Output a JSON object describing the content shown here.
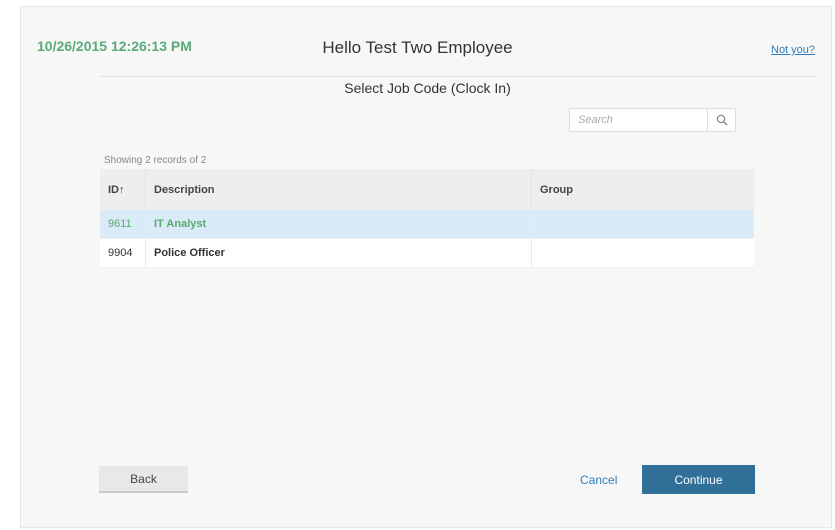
{
  "header": {
    "timestamp": "10/26/2015 12:26:13 PM",
    "greeting": "Hello Test Two Employee",
    "not_you_link": "Not you?"
  },
  "subtitle": "Select Job Code (Clock In)",
  "search": {
    "placeholder": "Search",
    "value": "",
    "icon": "search-icon"
  },
  "table": {
    "records_label": "Showing 2 records of 2",
    "columns": {
      "id": "ID↑",
      "description": "Description",
      "group": "Group"
    },
    "rows": [
      {
        "id": "9611",
        "description": "IT Analyst",
        "group": "",
        "selected": true
      },
      {
        "id": "9904",
        "description": "Police Officer",
        "group": "",
        "selected": false
      }
    ]
  },
  "footer": {
    "back_label": "Back",
    "cancel_label": "Cancel",
    "continue_label": "Continue"
  },
  "colors": {
    "timestamp": "#5aaa7a",
    "link": "#2f7fbf",
    "primary_button": "#2f6f98",
    "selected_row_bg": "#d8ebf7",
    "selected_row_text": "#5aaa6e"
  }
}
